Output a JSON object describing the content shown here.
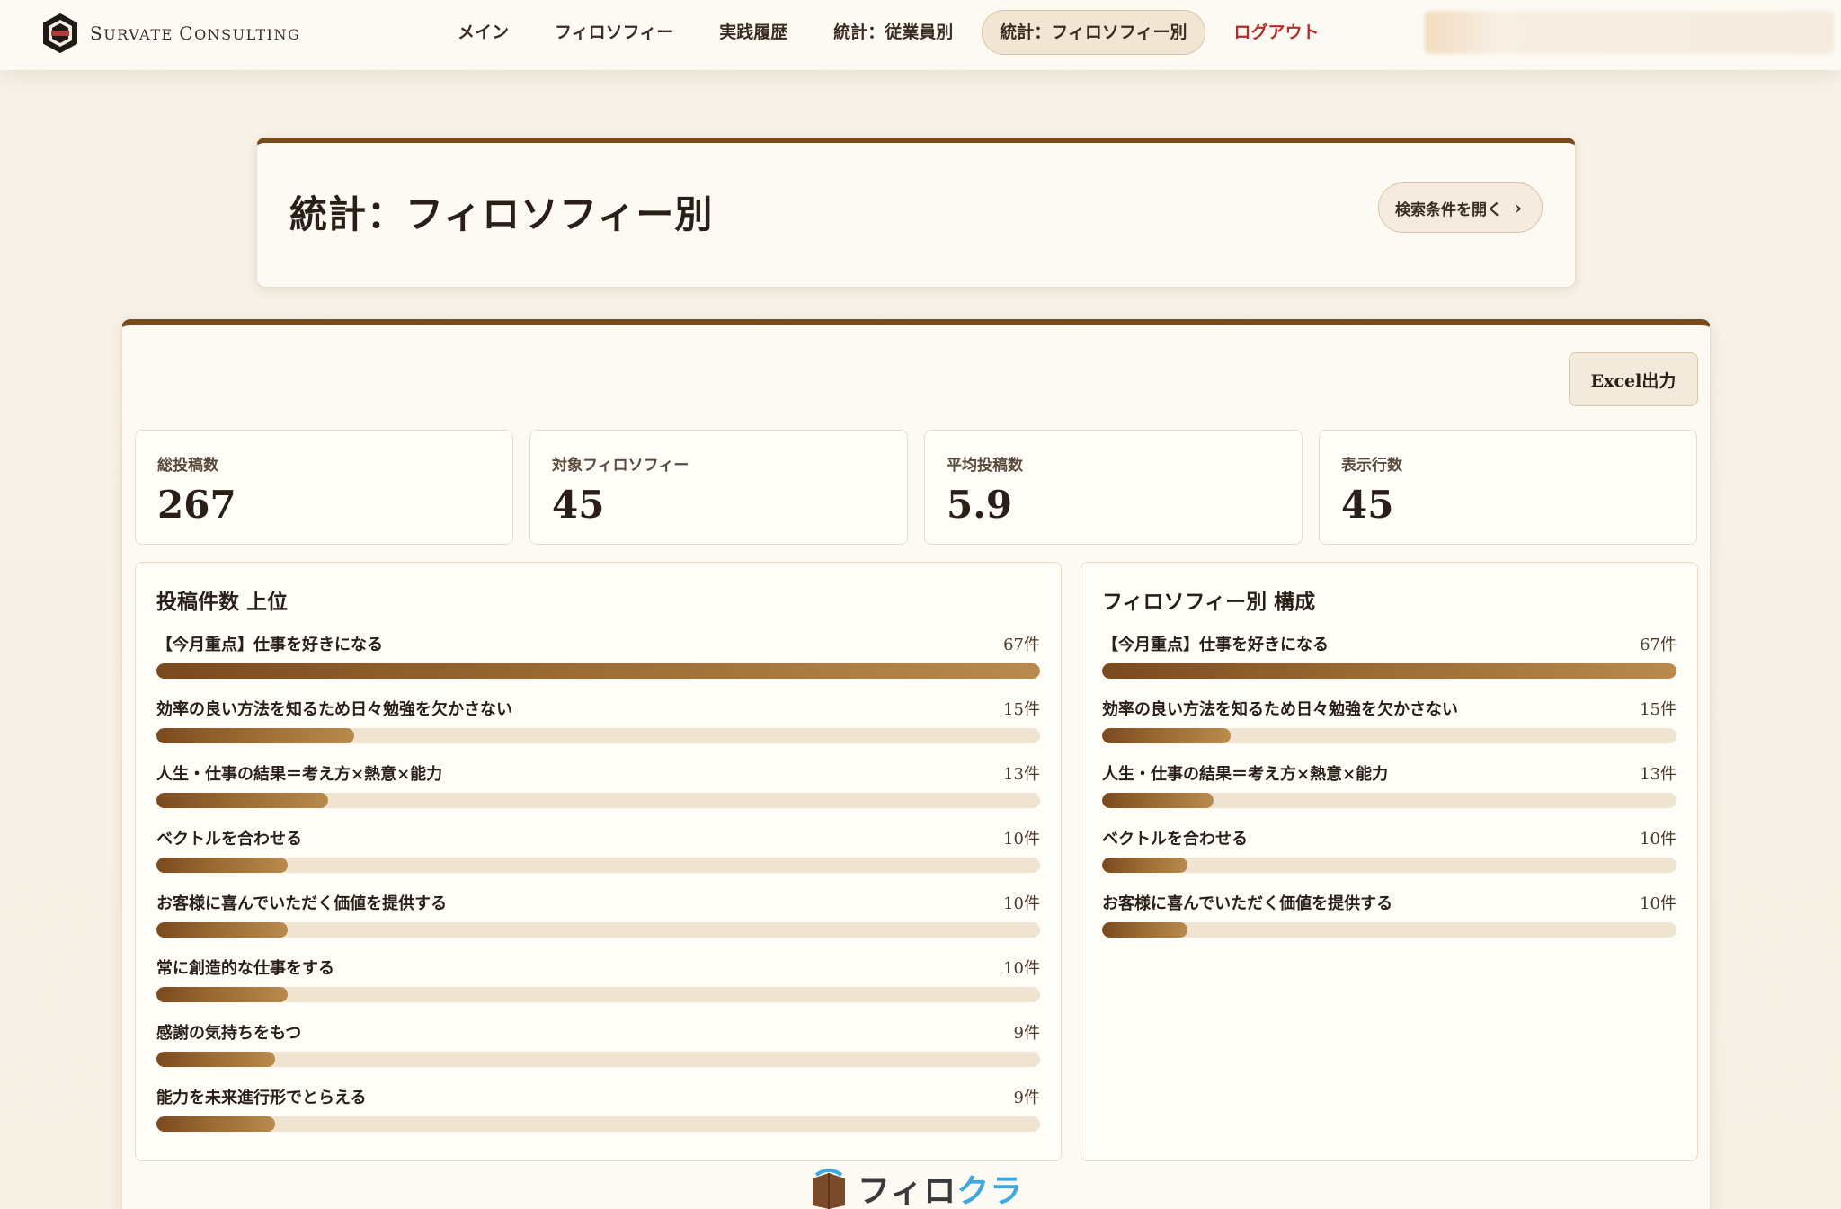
{
  "brand": {
    "name_first": "S",
    "name_rest": "URVATE ",
    "name_second": "C",
    "name_rest2": "ONSULTING"
  },
  "nav": {
    "items": [
      {
        "label": "メイン"
      },
      {
        "label": "フィロソフィー"
      },
      {
        "label": "実践履歴"
      },
      {
        "label": "統計：従業員別"
      },
      {
        "label": "統計：フィロソフィー別"
      }
    ],
    "logout": "ログアウト"
  },
  "header": {
    "title": "統計：フィロソフィー別",
    "search_toggle": "検索条件を開く"
  },
  "toolbar": {
    "excel": "Excel出力"
  },
  "kpis": [
    {
      "label": "総投稿数",
      "value": "267"
    },
    {
      "label": "対象フィロソフィー",
      "value": "45"
    },
    {
      "label": "平均投稿数",
      "value": "5.9"
    },
    {
      "label": "表示行数",
      "value": "45"
    }
  ],
  "top_posts": {
    "title": "投稿件数 上位",
    "rows": [
      {
        "label": "【今月重点】仕事を好きになる",
        "count_text": "67件",
        "fraction": 1.0
      },
      {
        "label": "効率の良い方法を知るため日々勉強を欠かさない",
        "count_text": "15件",
        "fraction": 0.224
      },
      {
        "label": "人生・仕事の結果＝考え方×熱意×能力",
        "count_text": "13件",
        "fraction": 0.194
      },
      {
        "label": "ベクトルを合わせる",
        "count_text": "10件",
        "fraction": 0.149
      },
      {
        "label": "お客様に喜んでいただく価値を提供する",
        "count_text": "10件",
        "fraction": 0.149
      },
      {
        "label": "常に創造的な仕事をする",
        "count_text": "10件",
        "fraction": 0.149
      },
      {
        "label": "感謝の気持ちをもつ",
        "count_text": "9件",
        "fraction": 0.134
      },
      {
        "label": "能力を未来進行形でとらえる",
        "count_text": "9件",
        "fraction": 0.134
      }
    ]
  },
  "composition": {
    "title": "フィロソフィー別 構成",
    "rows": [
      {
        "label": "【今月重点】仕事を好きになる",
        "count_text": "67件",
        "fraction": 1.0
      },
      {
        "label": "効率の良い方法を知るため日々勉強を欠かさない",
        "count_text": "15件",
        "fraction": 0.224
      },
      {
        "label": "人生・仕事の結果＝考え方×熱意×能力",
        "count_text": "13件",
        "fraction": 0.194
      },
      {
        "label": "ベクトルを合わせる",
        "count_text": "10件",
        "fraction": 0.149
      },
      {
        "label": "お客様に喜んでいただく価値を提供する",
        "count_text": "10件",
        "fraction": 0.149
      }
    ]
  },
  "footer": {
    "logo_dark": "フィロ",
    "logo_blue": "クラ"
  },
  "colors": {
    "accent": "#7a4a1f",
    "logout": "#b22c2c",
    "logo_blue": "#3ea8e0"
  }
}
